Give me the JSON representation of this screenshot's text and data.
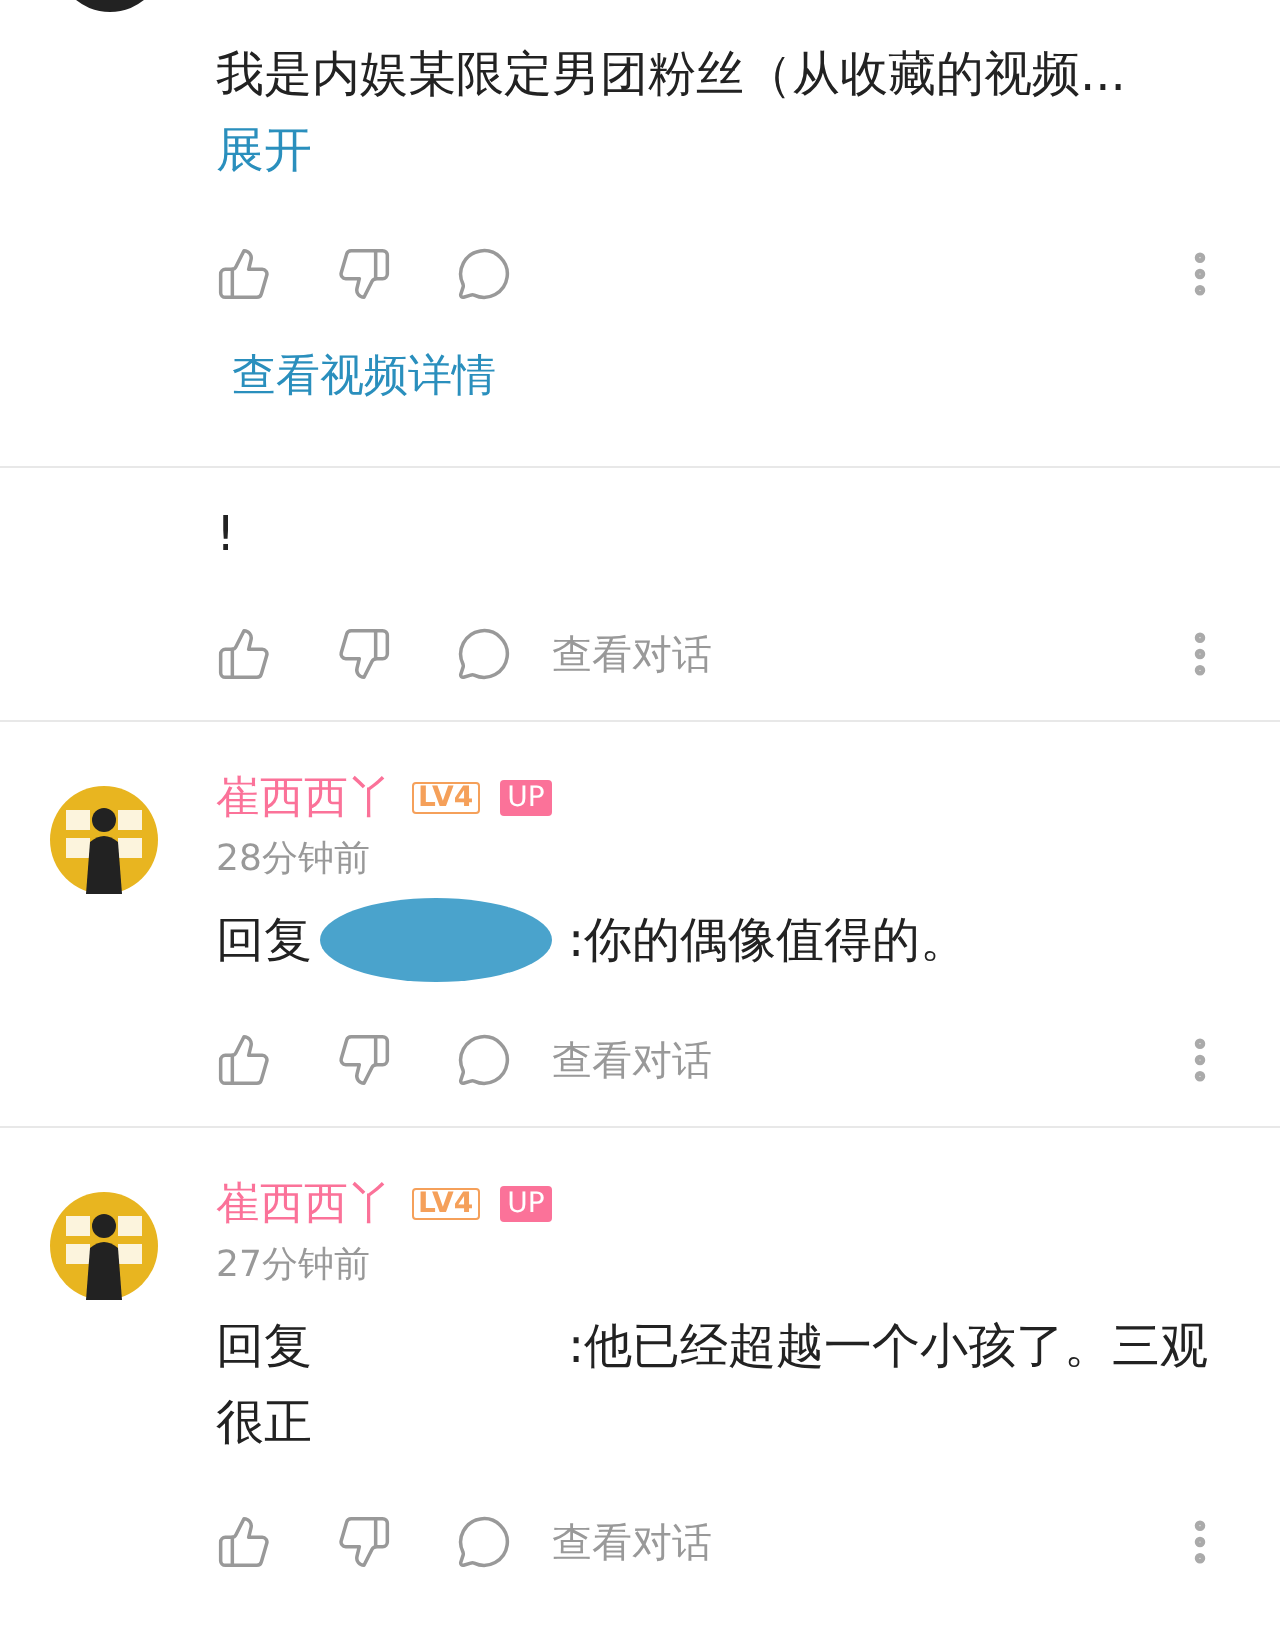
{
  "comments": [
    {
      "text": "我是内娱某限定男团粉丝（从收藏的视频...",
      "expand_link": "展开",
      "video_link": "查看视频详情"
    },
    {
      "text": "!",
      "view_conversation": "查看对话"
    },
    {
      "username": "崔西西丫",
      "level_badge": "LV4",
      "up_badge": "UP",
      "time": "28分钟前",
      "reply_label": "回复",
      "redacted": true,
      "text": ":你的偶像值得的。",
      "view_conversation": "查看对话"
    },
    {
      "username": "崔西西丫",
      "level_badge": "LV4",
      "up_badge": "UP",
      "time": "27分钟前",
      "reply_label": "回复",
      "redacted": false,
      "text": ":他已经超越一个小孩了。三观很正",
      "view_conversation": "查看对话"
    }
  ]
}
